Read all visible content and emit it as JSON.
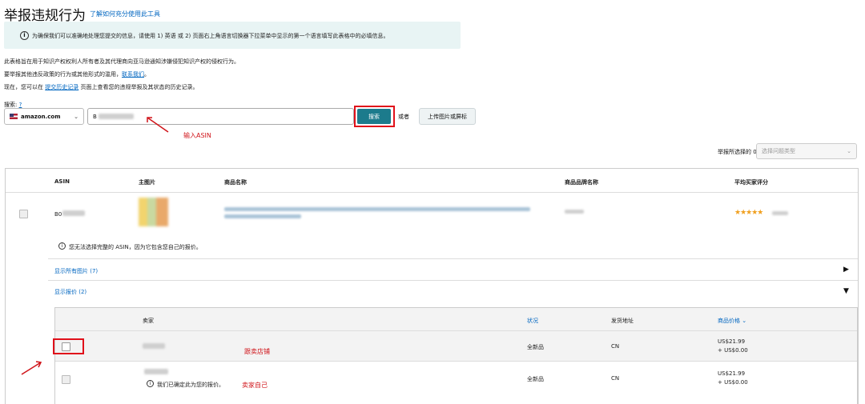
{
  "page": {
    "title": "举报违规行为",
    "title_link": "了解如何充分使用此工具",
    "info": "为确保我们可以准确地处理您提交的信息，请使用 1) 英语 或 2) 页面右上角语言切换器下拉菜单中显示的第一个语言填写此表格中的必填信息。",
    "para1": "此表格旨在用于知识产权权利人所有者及其代理商向亚马逊通知涉嫌侵犯知识产权的侵权行为。",
    "para2_prefix": "要举报其他违反政策的行为或其他形式的滥用，",
    "para2_link": "联系我们",
    "para2_suffix": "。",
    "para3_prefix": "现在，您可以在",
    "para3_link": "提交历史记录",
    "para3_suffix": "页面上查看您的违规举报及其状态的历史记录。"
  },
  "search": {
    "label": "搜索:",
    "help": "?",
    "marketplace": "amazon.com",
    "input_value": "B",
    "button": "搜索",
    "or": "或者",
    "upload_button": "上传图片或屏标"
  },
  "annotations": {
    "enter_asin": "输入ASIN",
    "violating_store": "跟卖店铺",
    "own_seller": "卖家自己"
  },
  "report": {
    "label": "举报所选择的 0 个：",
    "placeholder": "选择问题类型"
  },
  "table": {
    "headers": [
      "ASIN",
      "主图片",
      "商品名称",
      "商品品牌名称",
      "平均买家评分"
    ],
    "rows": [
      {
        "asin": "B0",
        "stars": "★★★★★"
      }
    ],
    "notice": "您无法选择完整的 ASIN，因为它包含您自己的报价。",
    "show_images": "显示所有图片 (7)",
    "show_offers": "显示报价 (2)"
  },
  "offers": {
    "headers": {
      "seller": "卖家",
      "condition": "状况",
      "ship_from": "发货地址",
      "price": "商品价格"
    },
    "rows": [
      {
        "condition": "全新品",
        "ship_from": "CN",
        "price": "US$21.99",
        "shipping": "+ US$0.00",
        "note": ""
      },
      {
        "condition": "全新品",
        "ship_from": "CN",
        "price": "US$21.99",
        "shipping": "+ US$0.00",
        "note": "我们已确定此为您的报价。"
      }
    ]
  }
}
